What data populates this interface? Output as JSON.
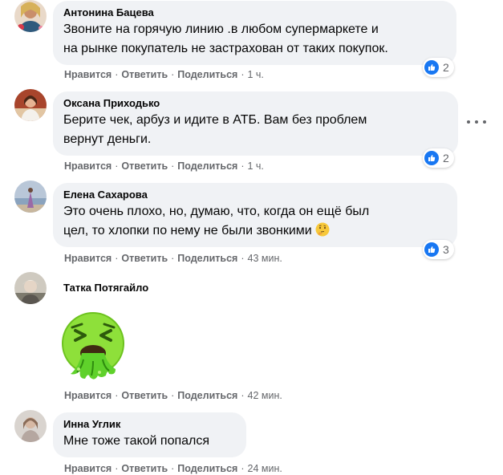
{
  "actions": {
    "like": "Нравится",
    "reply": "Ответить",
    "share": "Поделиться",
    "separator": "·"
  },
  "comments": [
    {
      "author": "Антонина Бацева",
      "text": "Звоните на горячую линию .в любом супермаркете и\nна рынке покупатель не застрахован от таких покупок.",
      "time": "1 ч.",
      "reaction": "like-icon",
      "reaction_count": "2"
    },
    {
      "author": "Оксана Приходько",
      "text": "Берите чек, арбуз и идите в АТБ. Вам без проблем\nвернут деньги.",
      "time": "1 ч.",
      "reaction": "like-icon",
      "reaction_count": "2"
    },
    {
      "author": "Елена Сахарова",
      "text": "Это очень плохо, но, думаю, что, когда он ещё был\nцел, то хлопки по нему не были звонкими",
      "emoji": "thinking-face-emoji",
      "time": "43 мин.",
      "reaction": "like-icon",
      "reaction_count": "3"
    },
    {
      "author": "Татка Потягайло",
      "sticker": "vomiting-face-sticker",
      "time": "42 мин."
    },
    {
      "author": "Инна Углик",
      "text": "Мне тоже такой попался",
      "time": "24 мин."
    }
  ],
  "colors": {
    "bubble": "#f0f2f5",
    "text": "#050505",
    "secondary": "#65676b",
    "like_blue": "#1877f2",
    "sticker_green": "#7ed321"
  }
}
